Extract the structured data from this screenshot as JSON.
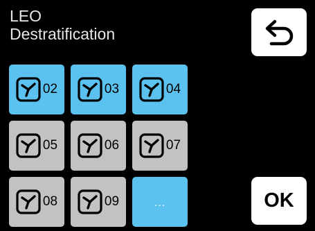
{
  "header": {
    "line1": "LEO",
    "line2": "Destratification"
  },
  "buttons": {
    "ok_label": "OK"
  },
  "units": [
    {
      "label": "02",
      "state": "active"
    },
    {
      "label": "03",
      "state": "active"
    },
    {
      "label": "04",
      "state": "active"
    },
    {
      "label": "05",
      "state": "inactive"
    },
    {
      "label": "06",
      "state": "inactive"
    },
    {
      "label": "07",
      "state": "inactive"
    },
    {
      "label": "08",
      "state": "inactive"
    },
    {
      "label": "09",
      "state": "inactive"
    }
  ],
  "more_label": "...",
  "colors": {
    "active": "#5bc1ee",
    "inactive": "#c2c2c2",
    "background": "#000000",
    "button": "#ffffff"
  },
  "icons": {
    "unit": "fan-icon",
    "back": "back-arrow-icon"
  }
}
